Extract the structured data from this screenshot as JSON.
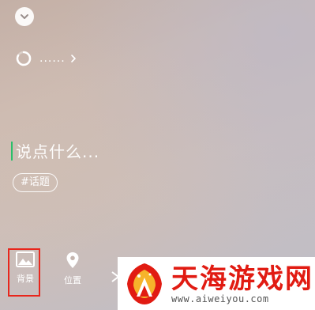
{
  "status": {
    "text": "......",
    "icon": "loading-ring-icon"
  },
  "composer": {
    "placeholder": "说点什么...",
    "topic_chip": "#话题"
  },
  "toolbar": {
    "background_label": "背景",
    "location_label": "位置"
  },
  "watermark": {
    "title": "天海游戏网",
    "url": "www.aiweiyou.com"
  },
  "colors": {
    "cursor": "#2bbf6a",
    "highlight": "#e8261c",
    "watermark_red": "#e11b12"
  }
}
